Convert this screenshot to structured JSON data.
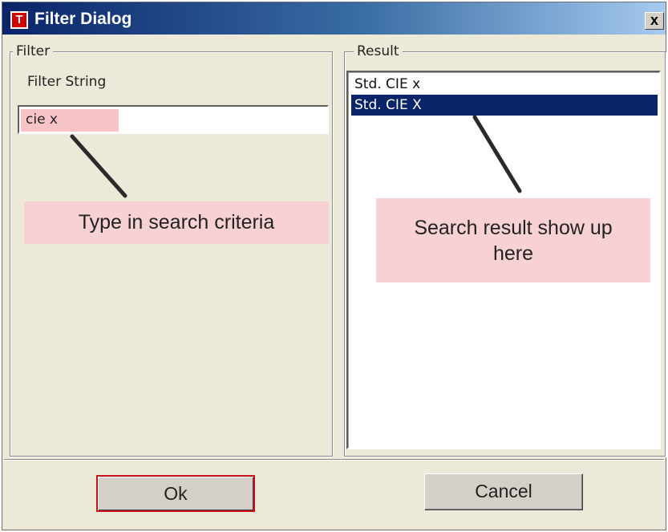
{
  "window": {
    "title": "Filter Dialog",
    "icon_letter": "T",
    "close_glyph": "x",
    "icon": "app-t-icon"
  },
  "filter_group": {
    "legend": "Filter",
    "field_label": "Filter String",
    "input_value": "cie x"
  },
  "result_group": {
    "legend": "Result",
    "items": [
      {
        "label": "Std. CIE x",
        "selected": false
      },
      {
        "label": "Std. CIE X",
        "selected": true
      }
    ]
  },
  "annotations": {
    "filter_callout": "Type in search criteria",
    "result_callout": "Search result show up here"
  },
  "buttons": {
    "ok": "Ok",
    "cancel": "Cancel"
  },
  "colors": {
    "title_gradient_start": "#0a246a",
    "title_gradient_end": "#a6caf0",
    "selection": "#0a246a",
    "highlight": "#f8c4c8",
    "callout": "#f8d1d4",
    "ok_focus_border": "#c8101a",
    "dialog_bg": "#ece9d8"
  }
}
